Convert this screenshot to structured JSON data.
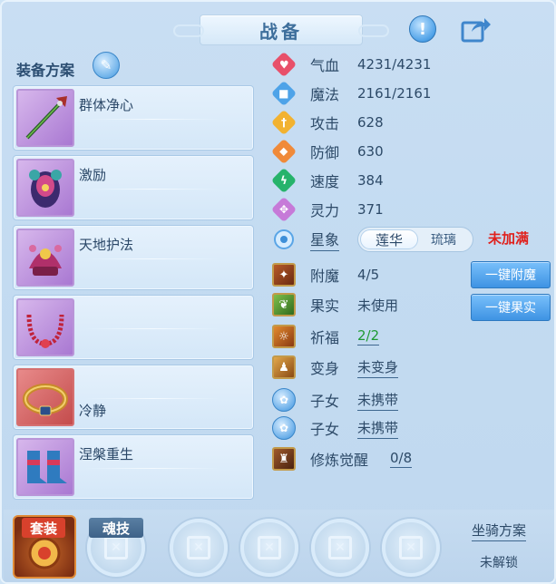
{
  "window": {
    "title": "战备"
  },
  "equip_scheme": {
    "label": "装备方案",
    "items": [
      {
        "name": "群体净心",
        "name_position": "top",
        "slot_color": "purple",
        "icon": "staff-icon"
      },
      {
        "name": "激励",
        "name_position": "top",
        "slot_color": "purple",
        "icon": "armor-icon"
      },
      {
        "name": "天地护法",
        "name_position": "top",
        "slot_color": "purple",
        "icon": "helmet-icon"
      },
      {
        "name": "",
        "name_position": "top",
        "slot_color": "purple",
        "icon": "necklace-icon"
      },
      {
        "name": "冷静",
        "name_position": "bottom",
        "slot_color": "red",
        "icon": "belt-icon"
      },
      {
        "name": "涅槃重生",
        "name_position": "top",
        "slot_color": "purple",
        "icon": "boots-icon"
      }
    ]
  },
  "stats": {
    "hp": {
      "label": "气血",
      "value": "4231/4231",
      "color": "#e8506a"
    },
    "mp": {
      "label": "魔法",
      "value": "2161/2161",
      "color": "#4ea3e8"
    },
    "atk": {
      "label": "攻击",
      "value": "628",
      "color": "#f2b230"
    },
    "def": {
      "label": "防御",
      "value": "630",
      "color": "#f08a3a"
    },
    "spd": {
      "label": "速度",
      "value": "384",
      "color": "#26b36b"
    },
    "spirit": {
      "label": "灵力",
      "value": "371",
      "color": "#c67ad8"
    }
  },
  "constellation": {
    "label": "星象",
    "option_selected": "莲华",
    "option_other": "琉璃",
    "status": "未加满"
  },
  "extras": {
    "enchant": {
      "label": "附魔",
      "value": "4/5"
    },
    "fruit": {
      "label": "果实",
      "value": "未使用"
    },
    "blessing": {
      "label": "祈福",
      "value": "2/2"
    },
    "transform": {
      "label": "变身",
      "value": "未变身"
    },
    "child1": {
      "label": "子女",
      "value": "未携带"
    },
    "child2": {
      "label": "子女",
      "value": "未携带"
    },
    "awaken": {
      "label": "修炼觉醒",
      "value": "0/8"
    }
  },
  "buttons": {
    "one_click_enchant": "一键附魔",
    "one_click_fruit": "一键果实"
  },
  "bottom": {
    "suit_label": "套装",
    "soul_skill_label": "魂技",
    "mount_scheme": "坐骑方案",
    "mount_status": "未解锁"
  }
}
